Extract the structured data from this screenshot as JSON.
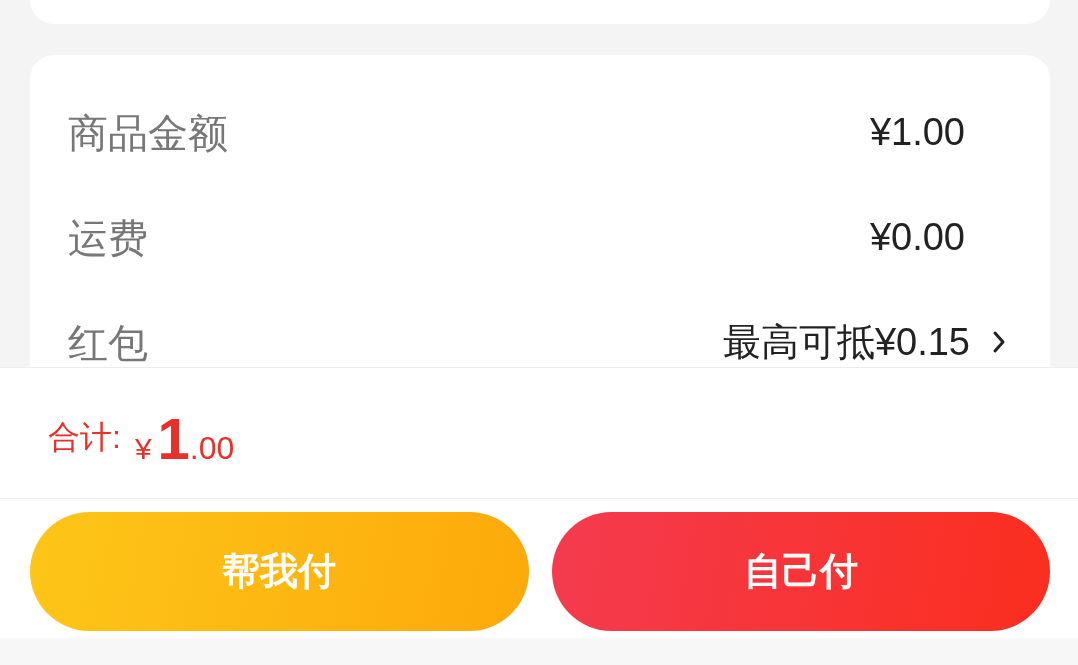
{
  "summary": {
    "rows": [
      {
        "label": "商品金额",
        "value": "¥1.00",
        "kind": "plain"
      },
      {
        "label": "运费",
        "value": "¥0.00",
        "kind": "plain"
      },
      {
        "label": "红包",
        "value": "最高可抵¥0.15",
        "kind": "link"
      }
    ]
  },
  "footer": {
    "total_label": "合计:",
    "currency": "¥",
    "amount_integer": "1",
    "amount_decimal": ".00"
  },
  "buttons": [
    {
      "label": "帮我付",
      "kind": "secondary"
    },
    {
      "label": "自己付",
      "kind": "primary"
    }
  ]
}
